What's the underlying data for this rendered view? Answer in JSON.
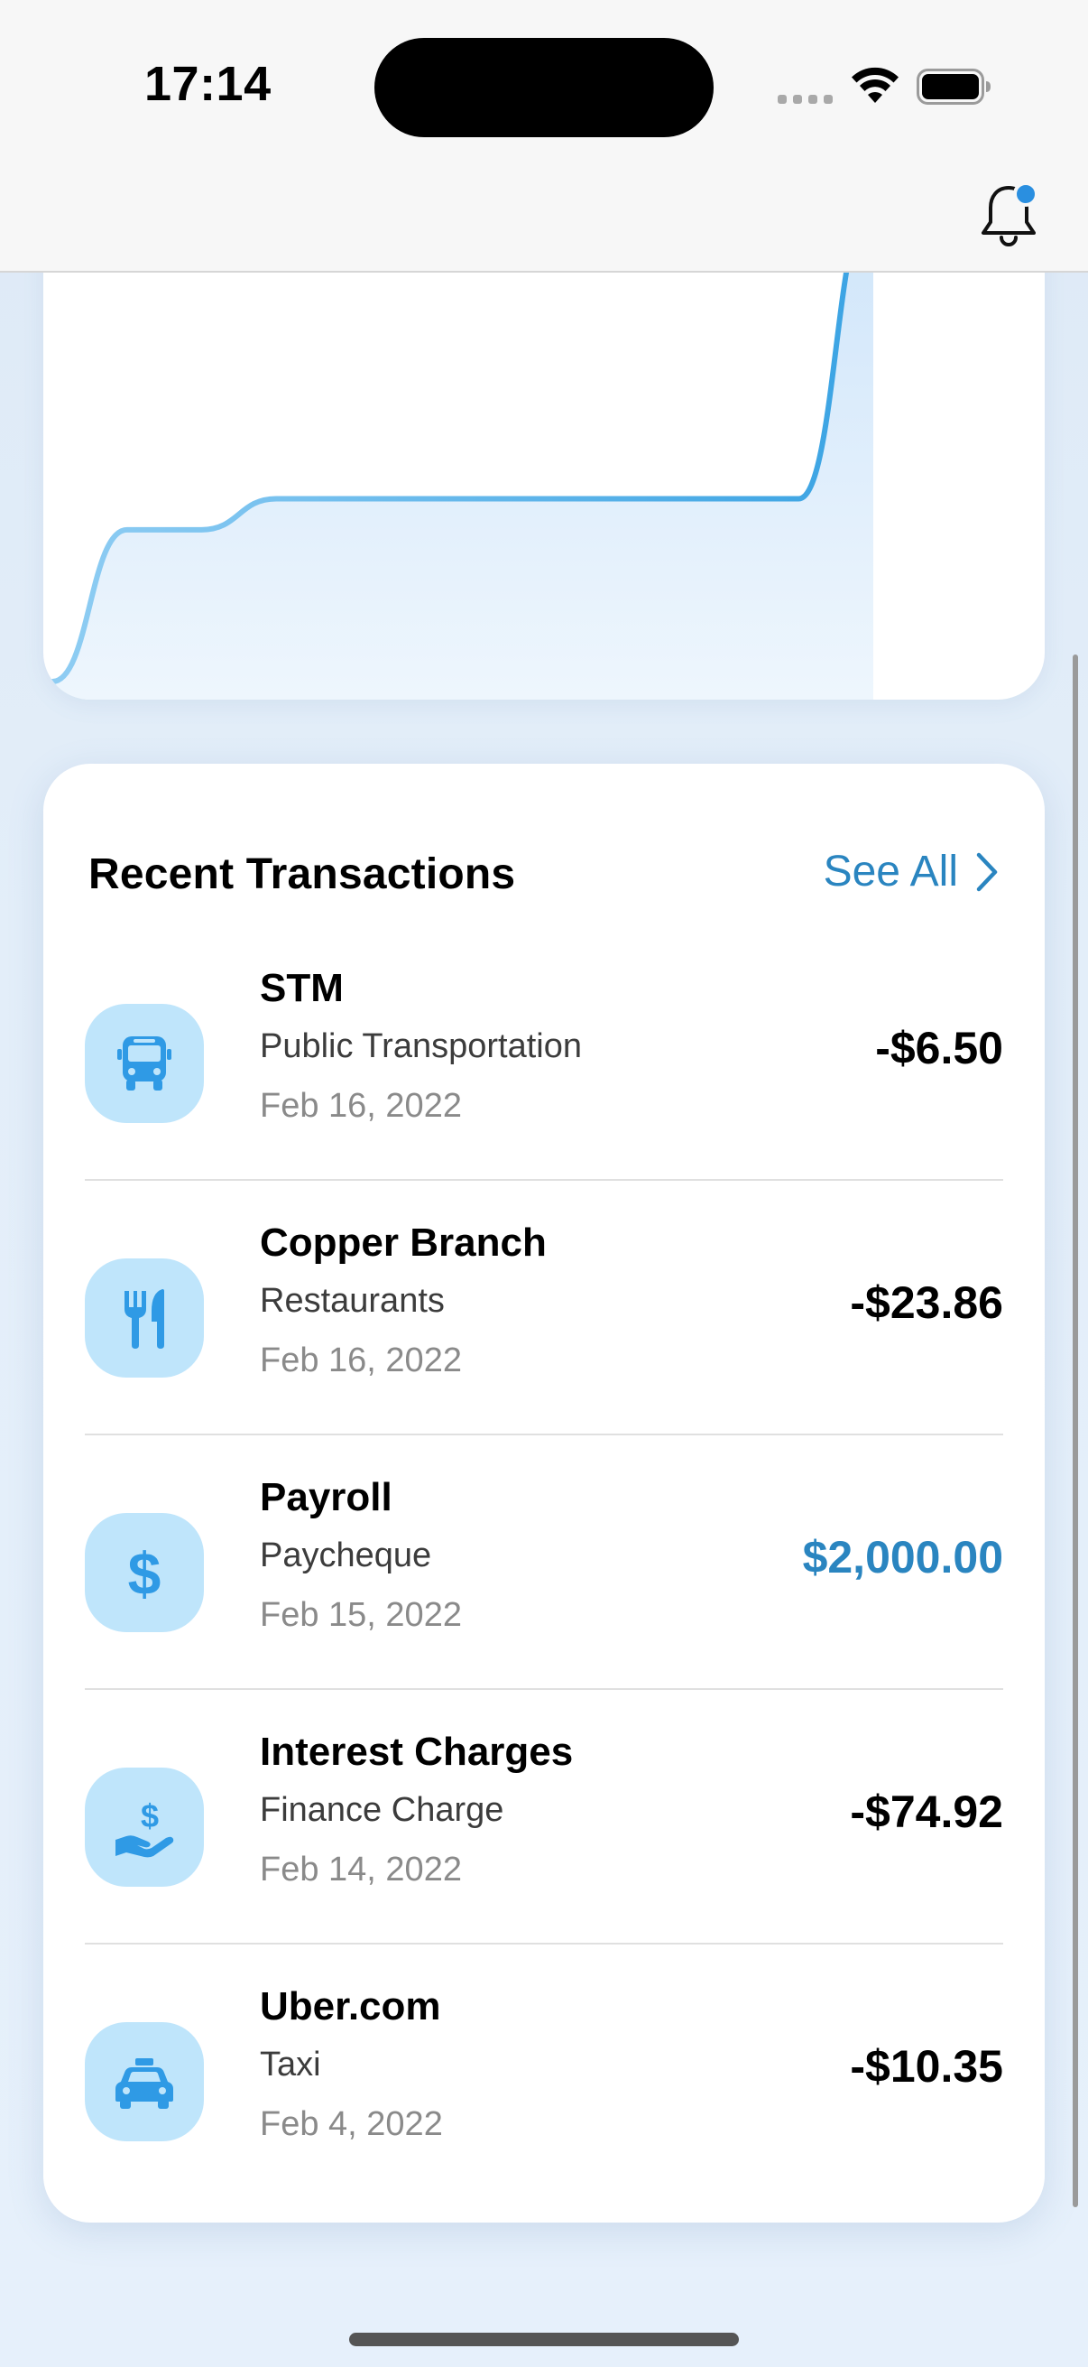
{
  "status_bar": {
    "time": "17:14"
  },
  "header": {
    "bell_icon": "bell-icon",
    "notification_badge": true,
    "badge_color": "#2a8fe0"
  },
  "colors": {
    "accent": "#2a85c0",
    "chart_line": "#3aa3e3",
    "icon_fg": "#2f9ae5",
    "icon_bg": "#bfe5fb"
  },
  "chart_data": {
    "type": "area",
    "title": "",
    "xlabel": "",
    "ylabel": "",
    "grid": false,
    "x": [
      0,
      1,
      2,
      3,
      4,
      5,
      6,
      7,
      8,
      9,
      10,
      11
    ],
    "series": [
      {
        "values": [
          0,
          44,
          44,
          53,
          53,
          53,
          53,
          53,
          53,
          53,
          53,
          140
        ]
      }
    ],
    "ylim": [
      0,
      140
    ]
  },
  "transactions": {
    "title": "Recent Transactions",
    "see_all": "See All",
    "items": [
      {
        "name": "STM",
        "category": "Public Transportation",
        "date": "Feb 16, 2022",
        "amount": "-$6.50",
        "positive": false,
        "icon": "bus-icon"
      },
      {
        "name": "Copper Branch",
        "category": "Restaurants",
        "date": "Feb 16, 2022",
        "amount": "-$23.86",
        "positive": false,
        "icon": "fork-knife-icon"
      },
      {
        "name": "Payroll",
        "category": "Paycheque",
        "date": "Feb 15, 2022",
        "amount": "$2,000.00",
        "positive": true,
        "icon": "dollar-icon"
      },
      {
        "name": "Interest Charges",
        "category": "Finance Charge",
        "date": "Feb 14, 2022",
        "amount": "-$74.92",
        "positive": false,
        "icon": "hand-dollar-icon"
      },
      {
        "name": "Uber.com",
        "category": "Taxi",
        "date": "Feb 4, 2022",
        "amount": "-$10.35",
        "positive": false,
        "icon": "taxi-icon"
      }
    ]
  }
}
